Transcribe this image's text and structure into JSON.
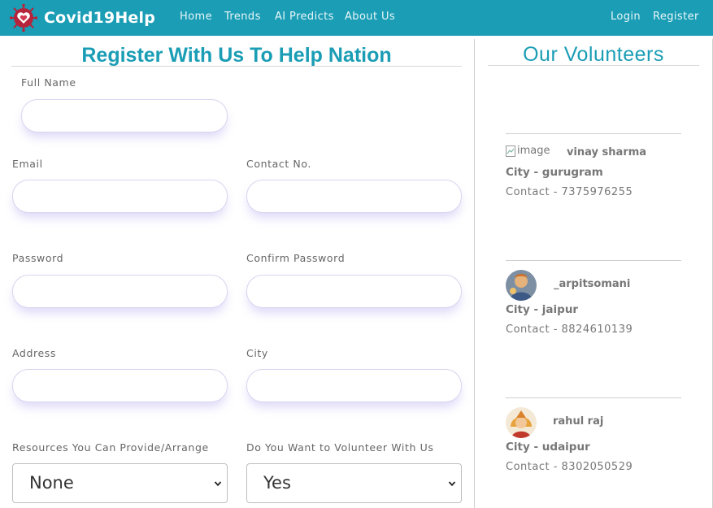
{
  "navbar": {
    "brand": "Covid19Help",
    "links": [
      "Home",
      "Trends",
      "AI Predicts",
      "About Us"
    ],
    "login": "Login",
    "register": "Register"
  },
  "form": {
    "title": "Register With Us To Help Nation",
    "full_name_label": "Full Name",
    "email_label": "Email",
    "contact_label": "Contact No.",
    "password_label": "Password",
    "confirm_password_label": "Confirm Password",
    "address_label": "Address",
    "city_label": "City",
    "resources_label": "Resources You Can Provide/Arrange",
    "resources_value": "None",
    "volunteer_label": "Do You Want to Volunteer With Us",
    "volunteer_value": "Yes"
  },
  "volunteers": {
    "title": "Our Volunteers",
    "items": [
      {
        "image_alt": "image",
        "name": "vinay sharma",
        "city": "City - gurugram",
        "contact": "Contact - 7375976255"
      },
      {
        "name": "_arpitsomani",
        "city": "City - jaipur",
        "contact": "Contact - 8824610139"
      },
      {
        "name": "rahul raj",
        "city": "City - udaipur",
        "contact": "Contact - 8302050529"
      }
    ]
  },
  "colors": {
    "accent": "#1a9db5",
    "navbar": "#1a9db5"
  }
}
